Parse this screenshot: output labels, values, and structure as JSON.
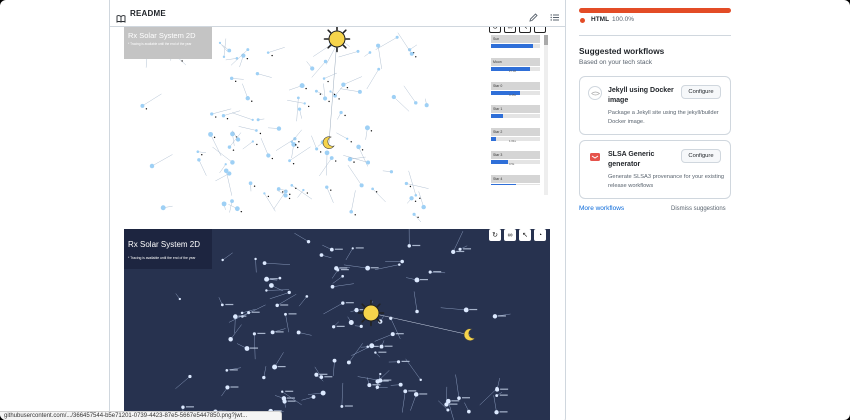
{
  "readme": {
    "title": "README",
    "icons": {
      "book": "book-icon",
      "edit": "pencil-icon",
      "toc": "list-unordered-icon"
    }
  },
  "screenshots": {
    "light": {
      "app_title": "Rx Solar System 2D",
      "app_subtitle": "* Tracing is available until the end of the year",
      "tools": [
        "reset-icon",
        "link-icon",
        "cursor-icon",
        "speed-icon"
      ],
      "planets": [
        {
          "name": "Sun",
          "value": "",
          "level": 0.85
        },
        {
          "name": "Moon",
          "value": "27.3d",
          "level": 0.8
        },
        {
          "name": "Star 0",
          "value": "0.15s",
          "level": 0.6
        },
        {
          "name": "Star 1",
          "value": "",
          "level": 0.25
        },
        {
          "name": "Star 2",
          "value": "1.01s",
          "level": 0.1
        },
        {
          "name": "Star 3",
          "value": "0.5s",
          "level": 0.35
        },
        {
          "name": "Star 4",
          "value": "",
          "level": 0.5
        }
      ]
    },
    "dark": {
      "app_title": "Rx Solar System 2D",
      "app_subtitle": "* Tracing is available until the end of the year",
      "tools": [
        "reset-icon",
        "link-icon",
        "cursor-icon",
        "speed-icon"
      ]
    }
  },
  "sidebar": {
    "language": {
      "name": "HTML",
      "percent": "100.0%",
      "color": "#e34c26"
    },
    "suggested": {
      "title": "Suggested workflows",
      "subtitle": "Based on your tech stack",
      "workflows": [
        {
          "name": "Jekyll using Docker image",
          "description": "Package a Jekyll site using the jekyll/builder Docker image.",
          "button": "Configure",
          "logo": "jekyll-logo"
        },
        {
          "name": "SLSA Generic generator",
          "description": "Generate SLSA3 provenance for your existing release workflows",
          "button": "Configure",
          "logo": "slsa-logo"
        }
      ],
      "more": "More workflows",
      "dismiss": "Dismiss suggestions"
    }
  },
  "status_bar": {
    "url": "githubusercontent.com/.../366457544-b5e71201-0739-4423-87e5-5667e5447850.png?jwt..."
  },
  "colors": {
    "accent": "#0969da",
    "dark_canvas": "#27324f",
    "star_light": "#9ed0f5",
    "sun": "#f6d44b"
  }
}
